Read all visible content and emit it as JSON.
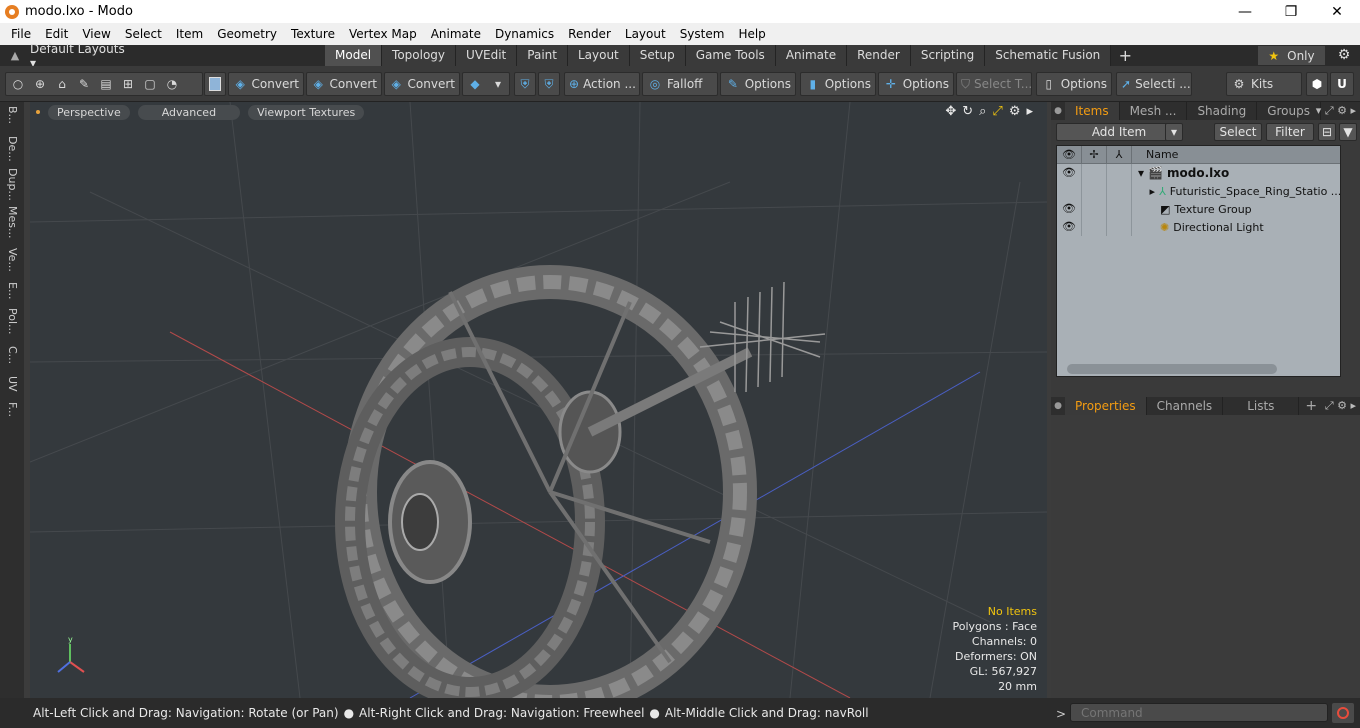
{
  "window": {
    "title": "modo.lxo - Modo",
    "minimize": "—",
    "maximize": "❐",
    "close": "✕"
  },
  "menu": [
    "File",
    "Edit",
    "View",
    "Select",
    "Item",
    "Geometry",
    "Texture",
    "Vertex Map",
    "Animate",
    "Dynamics",
    "Render",
    "Layout",
    "System",
    "Help"
  ],
  "layout_bar": {
    "default_layouts": "Default Layouts",
    "tabs": [
      "Model",
      "Topology",
      "UVEdit",
      "Paint",
      "Layout",
      "Setup",
      "Game Tools",
      "Animate",
      "Render",
      "Scripting",
      "Schematic Fusion"
    ],
    "active_tab": "Model",
    "only_label": "Only"
  },
  "toolbar": {
    "convert1": "Convert",
    "convert2": "Convert",
    "convert3": "Convert",
    "action": "Action ...",
    "falloff": "Falloff",
    "options1": "Options",
    "options2": "Options",
    "options3": "Options",
    "select_t": "Select T...",
    "options4": "Options",
    "selecti": "Selecti ...",
    "kits": "Kits"
  },
  "left_tabs": [
    "B...",
    "De...",
    "Dup...",
    "Mes...",
    "Ve...",
    "E...",
    "Pol...",
    "C...",
    "UV",
    "F..."
  ],
  "viewport": {
    "perspective": "Perspective",
    "advanced": "Advanced",
    "viewport_textures": "Viewport Textures",
    "info": {
      "no_items": "No Items",
      "polygons": "Polygons : Face",
      "channels": "Channels: 0",
      "deformers": "Deformers: ON",
      "gl": "GL: 567,927",
      "scale": "20 mm"
    }
  },
  "items_panel": {
    "tabs": [
      "Items",
      "Mesh ...",
      "Shading",
      "Groups"
    ],
    "active_tab": "Items",
    "add_item": "Add Item",
    "select": "Select",
    "filter": "Filter",
    "column_name": "Name",
    "rows": [
      {
        "name": "modo.lxo",
        "visible": true
      },
      {
        "name": "Futuristic_Space_Ring_Statio ...",
        "visible": false
      },
      {
        "name": "Texture Group",
        "visible": true
      },
      {
        "name": "Directional Light",
        "visible": true
      }
    ]
  },
  "properties_panel": {
    "tabs": [
      "Properties",
      "Channels",
      "Lists"
    ],
    "active_tab": "Properties"
  },
  "status": {
    "hint1": "Alt-Left Click and Drag: Navigation: Rotate (or Pan)",
    "hint2": "Alt-Right Click and Drag: Navigation: Freewheel",
    "hint3": "Alt-Middle Click and Drag: navRoll",
    "command_placeholder": "Command",
    "command_prompt": ">"
  },
  "colors": {
    "accent_orange": "#f39c12",
    "viewport_bg": "#34393d",
    "list_bg": "#a9b0b6"
  }
}
